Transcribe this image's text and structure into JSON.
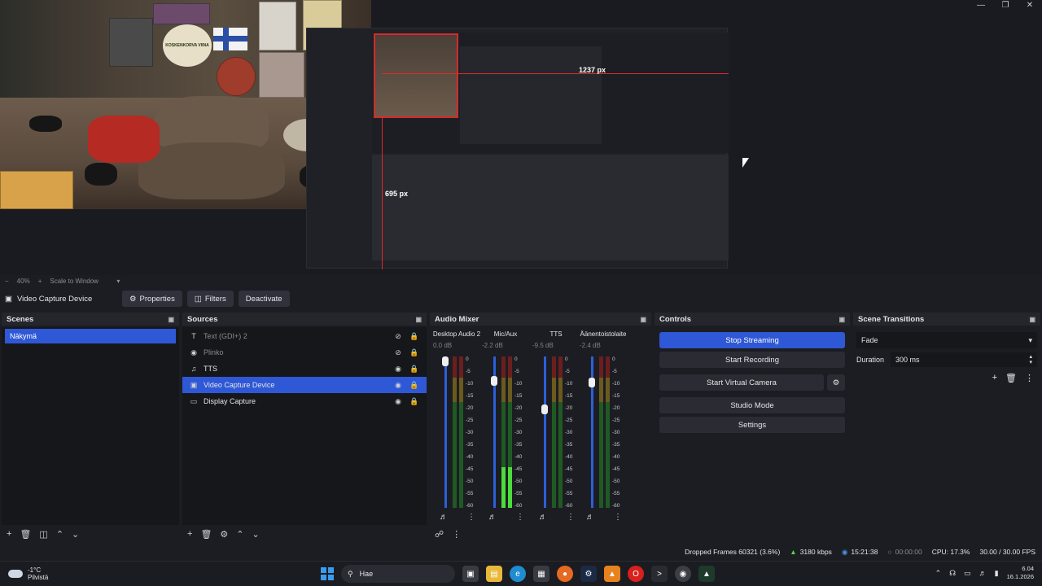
{
  "window": {
    "minimize": "—",
    "maximize": "❐",
    "close": "✕"
  },
  "preview": {
    "cam_logo_text": "KOSKENKORVA VIINA",
    "measure_width": "1237 px",
    "measure_height": "695 px"
  },
  "zoom": {
    "minus": "−",
    "level": "40%",
    "plus": "+",
    "mode": "Scale to Window",
    "caret": "▾"
  },
  "source_toolbar": {
    "selected_source": "Video Capture Device",
    "properties": "Properties",
    "filters": "Filters",
    "deactivate": "Deactivate"
  },
  "scenes": {
    "title": "Scenes",
    "items": [
      "Näkymä"
    ]
  },
  "sources": {
    "title": "Sources",
    "items": [
      {
        "label": "Text (GDI+) 2",
        "icon": "text-icon",
        "visible": false
      },
      {
        "label": "Plinko",
        "icon": "browser-icon",
        "visible": false
      },
      {
        "label": "TTS",
        "icon": "audio-icon",
        "visible": true
      },
      {
        "label": "Video Capture Device",
        "icon": "camera-icon",
        "visible": true,
        "selected": true
      },
      {
        "label": "Display Capture",
        "icon": "monitor-icon",
        "visible": true
      }
    ]
  },
  "mixer": {
    "title": "Audio Mixer",
    "scale": [
      "0",
      "-5",
      "-10",
      "-15",
      "-20",
      "-25",
      "-30",
      "-35",
      "-40",
      "-45",
      "-50",
      "-55",
      "-60"
    ],
    "channels": [
      {
        "name": "Desktop Audio 2",
        "db": "0.0 dB",
        "fader": 1.0,
        "level": 0.0
      },
      {
        "name": "Mic/Aux",
        "db": "-2.2 dB",
        "fader": 0.86,
        "level": 0.27
      },
      {
        "name": "TTS",
        "db": "-9.5 dB",
        "fader": 0.66,
        "level": 0.0
      },
      {
        "name": "Äänentoistolaite",
        "db": "-2.4 dB",
        "fader": 0.85,
        "level": 0.0
      }
    ]
  },
  "controls": {
    "title": "Controls",
    "stop_streaming": "Stop Streaming",
    "start_recording": "Start Recording",
    "start_virtual_camera": "Start Virtual Camera",
    "studio_mode": "Studio Mode",
    "settings": "Settings"
  },
  "transitions": {
    "title": "Scene Transitions",
    "selected": "Fade",
    "duration_label": "Duration",
    "duration_value": "300 ms"
  },
  "status": {
    "dropped_frames": "Dropped Frames 60321 (3.6%)",
    "bitrate": "3180 kbps",
    "stream_time": "15:21:38",
    "record_time": "00:00:00",
    "cpu": "CPU: 17.3%",
    "fps": "30.00 / 30.00 FPS"
  },
  "taskbar": {
    "temperature": "-1°C",
    "weather": "Pilvistä",
    "search_placeholder": "Hae",
    "time": "6.04",
    "date": "16.1.2026"
  },
  "colors": {
    "accent": "#2e58d6",
    "meter_green": "#4cdc3c",
    "measure_red": "#e02828"
  }
}
